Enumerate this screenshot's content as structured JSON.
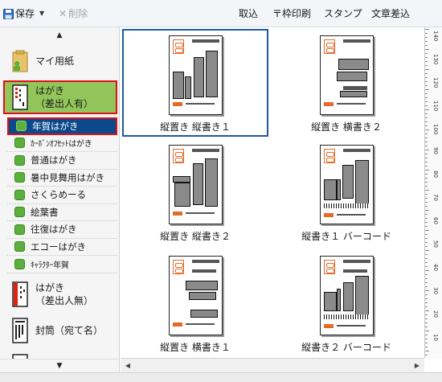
{
  "toolbar": {
    "save_label": "保存",
    "delete_label": "削除",
    "import_label": "取込",
    "frame_print_label": "〒枠印刷",
    "stamp_label": "スタンプ",
    "text_insert_label": "文章差込"
  },
  "sidebar": {
    "categories": [
      {
        "label": "マイ用紙",
        "icon": "folder-user-icon"
      },
      {
        "label_line1": "はがき",
        "label_line2": "（差出人有）",
        "icon": "postcard-icon"
      },
      {
        "label_line1": "はがき",
        "label_line2": "（差出人無）",
        "icon": "postcard-red-icon"
      },
      {
        "label": "封筒（宛て名）",
        "icon": "envelope-icon"
      }
    ],
    "subitems": [
      {
        "label": "年賀はがき",
        "selected": true
      },
      {
        "label": "ｶｰﾎﾞﾝｵﾌｾｯﾄはがき"
      },
      {
        "label": "普通はがき"
      },
      {
        "label": "暑中見舞用はがき"
      },
      {
        "label": "さくらめーる"
      },
      {
        "label": "絵葉書"
      },
      {
        "label": "往復はがき"
      },
      {
        "label": "エコーはがき"
      },
      {
        "label": "ｷｬﾗｸﾀｰ年賀"
      }
    ],
    "scroll_up": "▲",
    "scroll_down": "▼"
  },
  "templates": [
    {
      "caption": "縦置き 縦書き１",
      "selected": true
    },
    {
      "caption": "縦置き 横書き２"
    },
    {
      "caption": "縦置き 縦書き２"
    },
    {
      "caption": "縦書き１ バーコード"
    },
    {
      "caption": "縦置き 横書き１"
    },
    {
      "caption": "縦書き２ バーコード"
    }
  ],
  "ruler": {
    "labels": [
      "140",
      "130",
      "120",
      "110",
      "100",
      "90",
      "80",
      "70",
      "60",
      "50",
      "40",
      "30",
      "20",
      "10"
    ]
  },
  "colors": {
    "accent": "#0a4a8c",
    "category_selected": "#92c55a",
    "highlight_border": "#e0101a",
    "stamp_orange": "#e36b2a"
  }
}
